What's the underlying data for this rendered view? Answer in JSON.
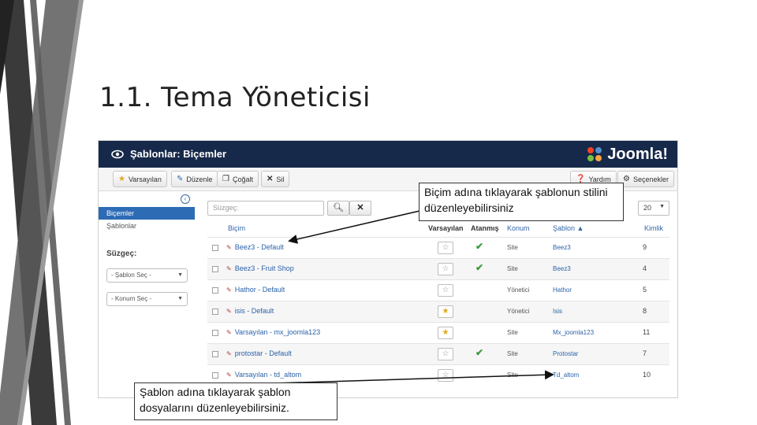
{
  "slide": {
    "title": "1.1. Tema Yöneticisi"
  },
  "app": {
    "header_title": "Şablonlar: Biçemler",
    "logo_text": "Joomla!",
    "toolbar": {
      "default": "Varsayılan",
      "edit": "Düzenle",
      "copy": "Çoğalt",
      "delete": "Sil",
      "help": "Yardım",
      "options": "Seçenekler"
    },
    "sidebar": {
      "items": [
        "Biçemler",
        "Şablonlar"
      ],
      "filter_title": "Süzgeç:",
      "template_select": "- Şablon Seç -",
      "location_select": "- Konum Seç -"
    },
    "search": {
      "placeholder": "Süzgeç:"
    },
    "limit_value": "20",
    "columns": {
      "style": "Biçim",
      "default": "Varsayılan",
      "assigned": "Atanmış",
      "location": "Konum",
      "template": "Şablon ▲",
      "id": "Kimlik"
    },
    "rows": [
      {
        "name": "Beez3 - Default",
        "default": false,
        "assigned": true,
        "location": "Site",
        "template": "Beez3",
        "id": "9"
      },
      {
        "name": "Beez3 - Fruit Shop",
        "default": false,
        "assigned": true,
        "location": "Site",
        "template": "Beez3",
        "id": "4"
      },
      {
        "name": "Hathor - Default",
        "default": false,
        "assigned": false,
        "location": "Yönetici",
        "template": "Hathor",
        "id": "5"
      },
      {
        "name": "isis - Default",
        "default": true,
        "assigned": false,
        "location": "Yönetici",
        "template": "Isis",
        "id": "8"
      },
      {
        "name": "Varsayılan - mx_joomla123",
        "default": true,
        "assigned": false,
        "location": "Site",
        "template": "Mx_joomla123",
        "id": "11"
      },
      {
        "name": "protostar - Default",
        "default": false,
        "assigned": true,
        "location": "Site",
        "template": "Protostar",
        "id": "7"
      },
      {
        "name": "Varsayılan - td_altom",
        "default": false,
        "assigned": false,
        "location": "Site",
        "template": "Td_altom",
        "id": "10"
      }
    ]
  },
  "callouts": {
    "style_note": "Biçim adına tıklayarak şablonun stilini düzenleyebilirsiniz",
    "template_note": "Şablon adına tıklayarak şablon dosyalarını düzenleyebilirsiniz."
  },
  "colors": {
    "header_bg": "#17294a",
    "accent_blue": "#2d6bb5",
    "deco_gray": "#4a4a4a"
  }
}
